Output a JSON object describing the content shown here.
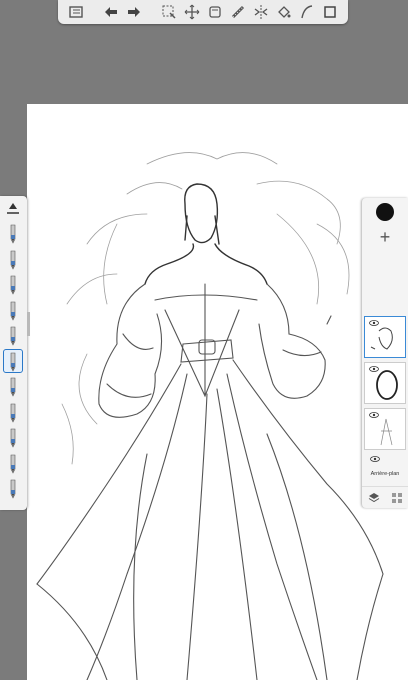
{
  "toolbar": {
    "tools": [
      {
        "name": "gallery-icon"
      },
      {
        "name": "undo-icon"
      },
      {
        "name": "redo-icon"
      },
      {
        "name": "selection-icon"
      },
      {
        "name": "transform-icon"
      },
      {
        "name": "layer-tool-icon"
      },
      {
        "name": "ruler-icon"
      },
      {
        "name": "symmetry-icon"
      },
      {
        "name": "fill-icon"
      },
      {
        "name": "curve-icon"
      },
      {
        "name": "fullscreen-icon"
      }
    ]
  },
  "brushes": {
    "count": 11,
    "selected_index": 5
  },
  "layers": {
    "current_color": "#111111",
    "background_label": "Arrière-plan",
    "active_layer": 1
  },
  "colors": {
    "workspace": "#7b7b7b",
    "accent": "#3a8ad6"
  }
}
